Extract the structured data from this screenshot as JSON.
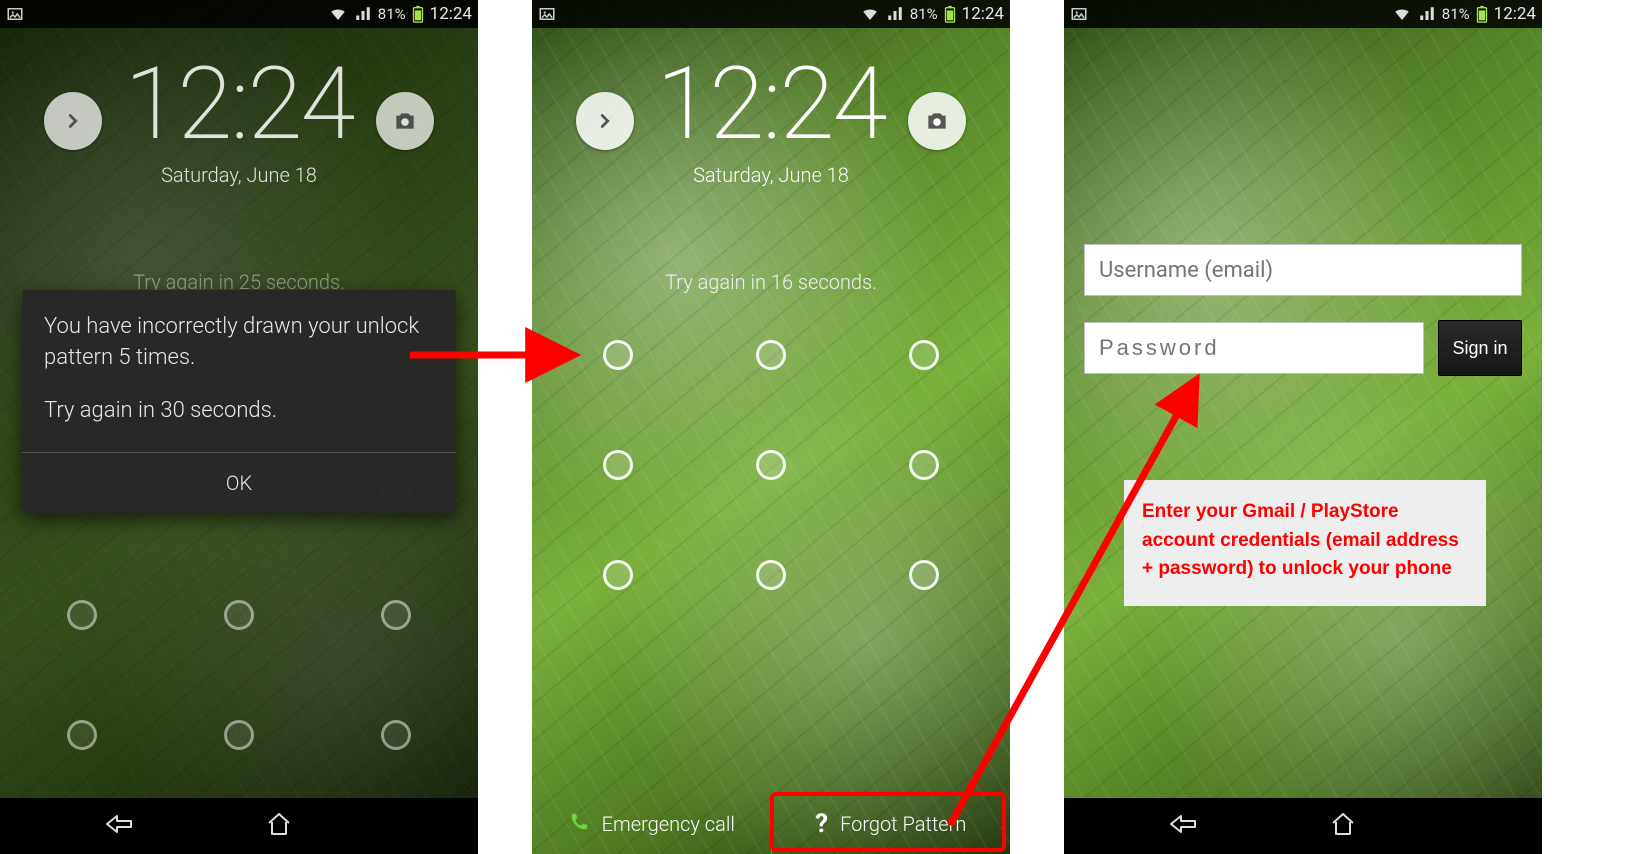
{
  "status": {
    "battery_pct": "81%",
    "clock": "12:24"
  },
  "lock": {
    "time": "12:24",
    "date": "Saturday, June 18"
  },
  "screen1": {
    "try_hint": "Try again in 25 seconds.",
    "dialog_line1": "You have incorrectly drawn your unlock pattern 5 times.",
    "dialog_line2": "Try again in 30 seconds.",
    "ok": "OK"
  },
  "screen2": {
    "try_hint": "Try again in 16 seconds.",
    "emergency": "Emergency call",
    "forgot": "Forgot Pattern"
  },
  "screen3": {
    "username_ph": "Username (email)",
    "password_ph": "Password",
    "signin": "Sign in",
    "note": "Enter your Gmail / PlayStore account credentials (email address + password) to unlock your phone"
  }
}
